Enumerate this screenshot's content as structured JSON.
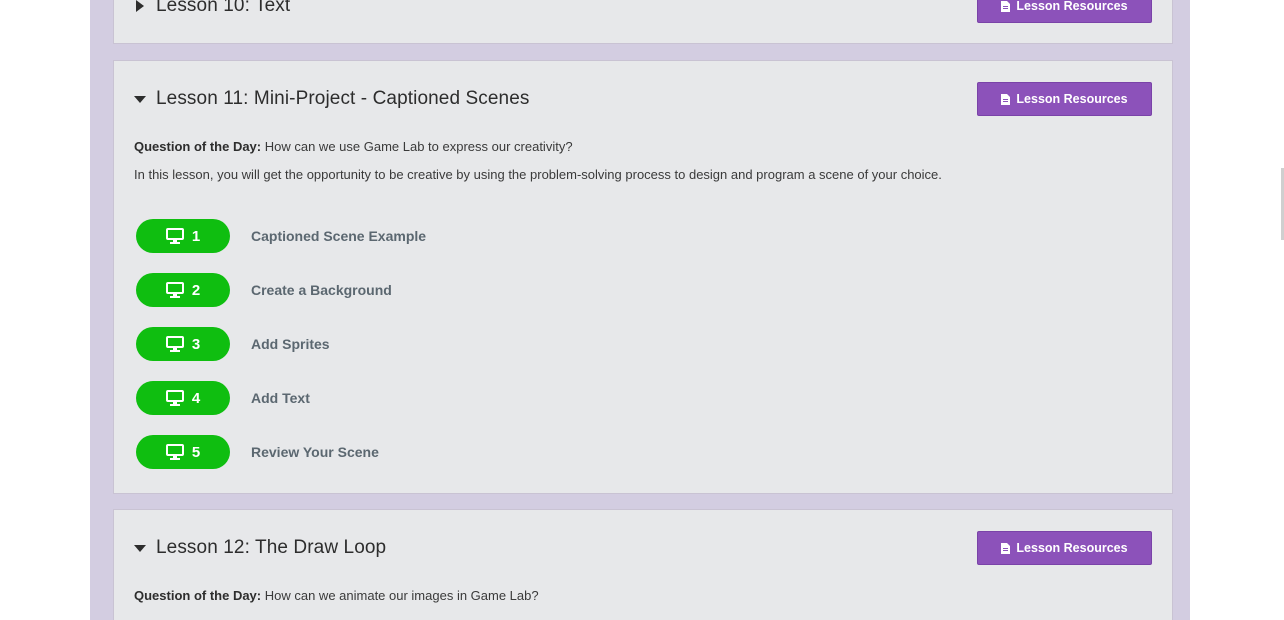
{
  "lessons": [
    {
      "title": "Lesson 10: Text",
      "expanded": false,
      "resources_label": "Lesson Resources"
    },
    {
      "title": "Lesson 11: Mini-Project - Captioned Scenes",
      "expanded": true,
      "resources_label": "Lesson Resources",
      "qotd_label": "Question of the Day:",
      "qotd_text": " How can we use Game Lab to express our creativity?",
      "description": "In this lesson, you will get the opportunity to be creative by using the problem-solving process to design and program a scene of your choice.",
      "levels": [
        {
          "number": "1",
          "name": "Captioned Scene Example",
          "icon": "desktop-icon"
        },
        {
          "number": "2",
          "name": "Create a Background",
          "icon": "desktop-icon"
        },
        {
          "number": "3",
          "name": "Add Sprites",
          "icon": "desktop-icon"
        },
        {
          "number": "4",
          "name": "Add Text",
          "icon": "desktop-icon"
        },
        {
          "number": "5",
          "name": "Review Your Scene",
          "icon": "desktop-icon"
        }
      ]
    },
    {
      "title": "Lesson 12: The Draw Loop",
      "expanded": true,
      "resources_label": "Lesson Resources",
      "qotd_label": "Question of the Day:",
      "qotd_text": " How can we animate our images in Game Lab?"
    }
  ],
  "colors": {
    "unit_background": "#d3cde1",
    "card_background": "#e7e8ea",
    "resources_button": "#8c52ba",
    "level_bubble": "#0fbe10",
    "level_name": "#5b6770"
  }
}
